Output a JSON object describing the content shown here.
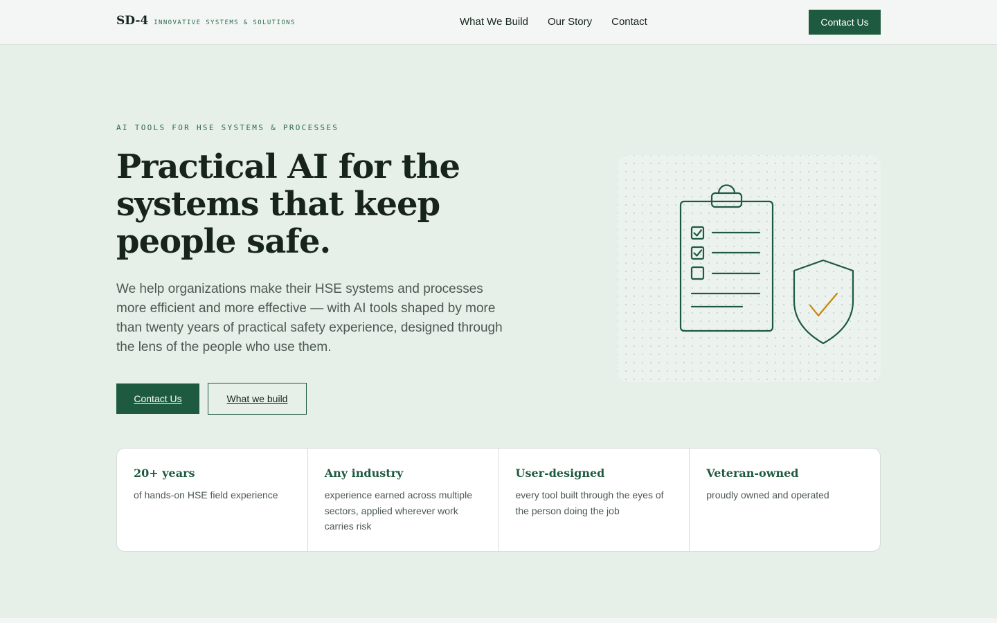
{
  "nav": {
    "brand_name": "SD-4",
    "brand_tagline": "INNOVATIVE SYSTEMS & SOLUTIONS",
    "links": [
      "What We Build",
      "Our Story",
      "Contact"
    ],
    "cta_label": "Contact Us"
  },
  "hero": {
    "eyebrow": "AI TOOLS FOR HSE SYSTEMS & PROCESSES",
    "headline": "Practical AI for the systems that keep people safe.",
    "lede": "We help organizations make their HSE systems and processes more efficient and more effective — with AI tools shaped by more than twenty years of practical safety experience, designed through the lens of the people who use them.",
    "primary_button": "Contact Us",
    "secondary_button": "What we build"
  },
  "illustration": {
    "icons": [
      "clipboard-checklist-icon",
      "shield-check-icon"
    ],
    "checklist_checked": [
      true,
      true,
      false
    ]
  },
  "stats": [
    {
      "title": "20+ years",
      "description": "of hands-on HSE field experience"
    },
    {
      "title": "Any industry",
      "description": "experience earned across multiple sectors, applied wherever work carries risk"
    },
    {
      "title": "User-designed",
      "description": "every tool built through the eyes of the person doing the job"
    },
    {
      "title": "Veteran-owned",
      "description": "proudly owned and operated"
    }
  ],
  "colors": {
    "accent": "#1e5a3f",
    "background": "#e6efe8",
    "check_accent": "#c8860a"
  }
}
